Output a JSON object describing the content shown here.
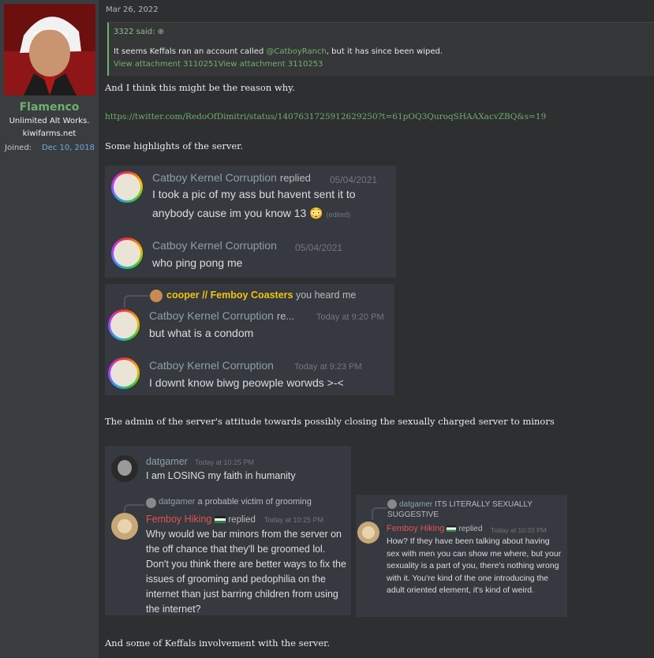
{
  "author": {
    "name": "Flamenco",
    "title": "Unlimited Alt Works.",
    "site": "kiwifarms.net",
    "joined_label": "Joined:",
    "joined_value": "Dec 10, 2018"
  },
  "post": {
    "date": "Mar 26, 2022",
    "quote": {
      "header": "3322 said: ⊕",
      "body_prefix": "It seems Keffals ran an account called ",
      "body_mention": "@CatboyRanch",
      "body_suffix": ", but it has since been wiped.",
      "attachments": "View attachment 3110251View attachment 3110253"
    },
    "p1": "And I think this might be the reason why.",
    "link": "https://twitter.com/RedoOfDimitri/status/1407631725912629250?t=61pOQ3QuroqSHAAXacvZBQ&s=19",
    "p2": "Some highlights of the server.",
    "p3": "The admin of the server's attitude towards possibly closing the sexually charged server to minors",
    "p4": "And some of Keffals involvement with the server."
  },
  "discord1": {
    "m1": {
      "name": "Catboy Kernel Corruption",
      "replied": "replied",
      "time": "05/04/2021",
      "line1": "I took a pic of my ass but havent sent it to",
      "line2": "anybody cause im you know 13",
      "emoji": "😳",
      "edited": "(edited)"
    },
    "m2": {
      "name": "Catboy Kernel Corruption",
      "time": "05/04/2021",
      "text": "who ping pong me"
    }
  },
  "discord2": {
    "reply": {
      "name": "cooper // Femboy Coasters",
      "text": "you heard me"
    },
    "m1": {
      "name": "Catboy Kernel Corruption",
      "extra": "re...",
      "time": "Today at 9:20 PM",
      "text": "but what is a condom"
    },
    "m2": {
      "name": "Catboy Kernel Corruption",
      "time": "Today at 9:23 PM",
      "text": "I downt know biwg peowple worwds >-<"
    }
  },
  "discord3": {
    "m1": {
      "name": "datgamer",
      "time": "Today at 10:25 PM",
      "text": "I am LOSING my faith in humanity"
    },
    "reply": {
      "name": "datgamer",
      "text": "a probable victim of grooming"
    },
    "m2": {
      "name": "Femboy Hiking",
      "replied": "replied",
      "time": "Today at 10:25 PM",
      "text": "Why would we bar minors from the server on the off chance that they'll be groomed lol. Don't you think there are better ways to fix the issues of grooming and pedophilia on the internet than just barring children from using the internet?"
    }
  },
  "discord4": {
    "reply": {
      "name": "datgamer",
      "text": "ITS LITERALLY SEXUALLY SUGGESTIVE"
    },
    "m1": {
      "name": "Femboy Hiking",
      "replied": "replied",
      "time": "Today at 10:33 PM",
      "text": "How? If they have been talking about having sex with men you can show me where,  but your sexuality is a part of you, there's nothing wrong with it. You're kind of the one introducing the adult oriented element, it's kind of weird."
    }
  },
  "colors": {
    "accent_green": "#6fb06c",
    "discord_bg": "#36393f",
    "name_red": "#e0554f",
    "name_yellow": "#f1c40f"
  }
}
